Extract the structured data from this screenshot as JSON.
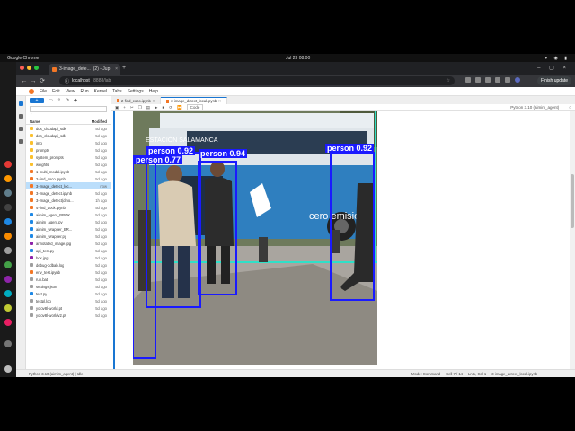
{
  "os_bar": {
    "app_name": "Google Chrome",
    "clock": "Jul 23 08:00"
  },
  "browser": {
    "tab_title": "3-image_dete...",
    "tab_badge": "(2) - Jup",
    "new_tab": "+",
    "url_host": "localhost",
    "url_path": ":8888/lab",
    "finish_update": "Finish update"
  },
  "jupyter": {
    "menu": [
      "File",
      "Edit",
      "View",
      "Run",
      "Kernel",
      "Tabs",
      "Settings",
      "Help"
    ],
    "filebrowser": {
      "new_label": "+",
      "path": "/",
      "col_name": "Name",
      "col_modified": "Modified",
      "files": [
        {
          "name": "dds_cloudapi_sdk",
          "modified": "5d ago",
          "type": "folder"
        },
        {
          "name": "dds_cloudapi_sdk",
          "modified": "5d ago",
          "type": "folder"
        },
        {
          "name": "img",
          "modified": "5d ago",
          "type": "folder"
        },
        {
          "name": "prompts",
          "modified": "5d ago",
          "type": "folder"
        },
        {
          "name": "system_prompts",
          "modified": "5d ago",
          "type": "folder"
        },
        {
          "name": "weights",
          "modified": "5d ago",
          "type": "folder"
        },
        {
          "name": "1-multi_modal.ipynb",
          "modified": "5d ago",
          "type": "notebook"
        },
        {
          "name": "2-find_coco.ipynb",
          "modified": "5d ago",
          "type": "notebook"
        },
        {
          "name": "3-image_detect_loc...",
          "modified": "now",
          "type": "notebook",
          "selected": true
        },
        {
          "name": "3-image_detect.ipynb",
          "modified": "5d ago",
          "type": "notebook"
        },
        {
          "name": "3-image_detect(dino...",
          "modified": "1h ago",
          "type": "notebook"
        },
        {
          "name": "4-find_dock.ipynb",
          "modified": "5d ago",
          "type": "notebook"
        },
        {
          "name": "aimim_agent_BROK...",
          "modified": "5d ago",
          "type": "py"
        },
        {
          "name": "aimim_agent.py",
          "modified": "5d ago",
          "type": "py"
        },
        {
          "name": "aimim_wrapper_BR...",
          "modified": "5d ago",
          "type": "py"
        },
        {
          "name": "aimim_wrapper.py",
          "modified": "5d ago",
          "type": "py"
        },
        {
          "name": "annotated_image.jpg",
          "modified": "5d ago",
          "type": "img"
        },
        {
          "name": "api_test.py",
          "modified": "5d ago",
          "type": "py"
        },
        {
          "name": "box.jpg",
          "modified": "5d ago",
          "type": "img"
        },
        {
          "name": "debug-3dbab.log",
          "modified": "5d ago",
          "type": "file"
        },
        {
          "name": "env_test.ipynb",
          "modified": "5d ago",
          "type": "notebook"
        },
        {
          "name": "run.bat",
          "modified": "5d ago",
          "type": "file"
        },
        {
          "name": "settings.json",
          "modified": "5d ago",
          "type": "file"
        },
        {
          "name": "test.py",
          "modified": "5d ago",
          "type": "py"
        },
        {
          "name": "testpl.log",
          "modified": "5d ago",
          "type": "file"
        },
        {
          "name": "yolov8l-world.pt",
          "modified": "5d ago",
          "type": "file"
        },
        {
          "name": "yolov8l-worldv2.pt",
          "modified": "5d ago",
          "type": "file"
        }
      ]
    },
    "doc_tabs": [
      {
        "label": "2-find_coco.ipynb",
        "active": false
      },
      {
        "label": "3-image_detect_local.ipynb",
        "active": true
      }
    ],
    "toolbar": {
      "cell_type": "Code",
      "kernel": "Python 3.10 (aimim_agent)"
    },
    "detections": [
      {
        "label": "person 0.92"
      },
      {
        "label": "person 0.77"
      },
      {
        "label": "person 0.94"
      },
      {
        "label": "person 0.92"
      }
    ],
    "bus_text": {
      "brand": "cero emisione",
      "route": "ESTACIÓN SALAMANCA"
    },
    "status": {
      "kernel": "Python 3.10 (aimim_agent) | Idle",
      "mode": "Mode: Command",
      "cell": "Cell 7 / 14",
      "position": "Ln 1, Col 1",
      "file": "3-image_detect_local.ipynb"
    }
  },
  "colors": {
    "accent": "#1976d2",
    "detection_box": "#1a1aff",
    "jupyter_orange": "#f37726"
  }
}
